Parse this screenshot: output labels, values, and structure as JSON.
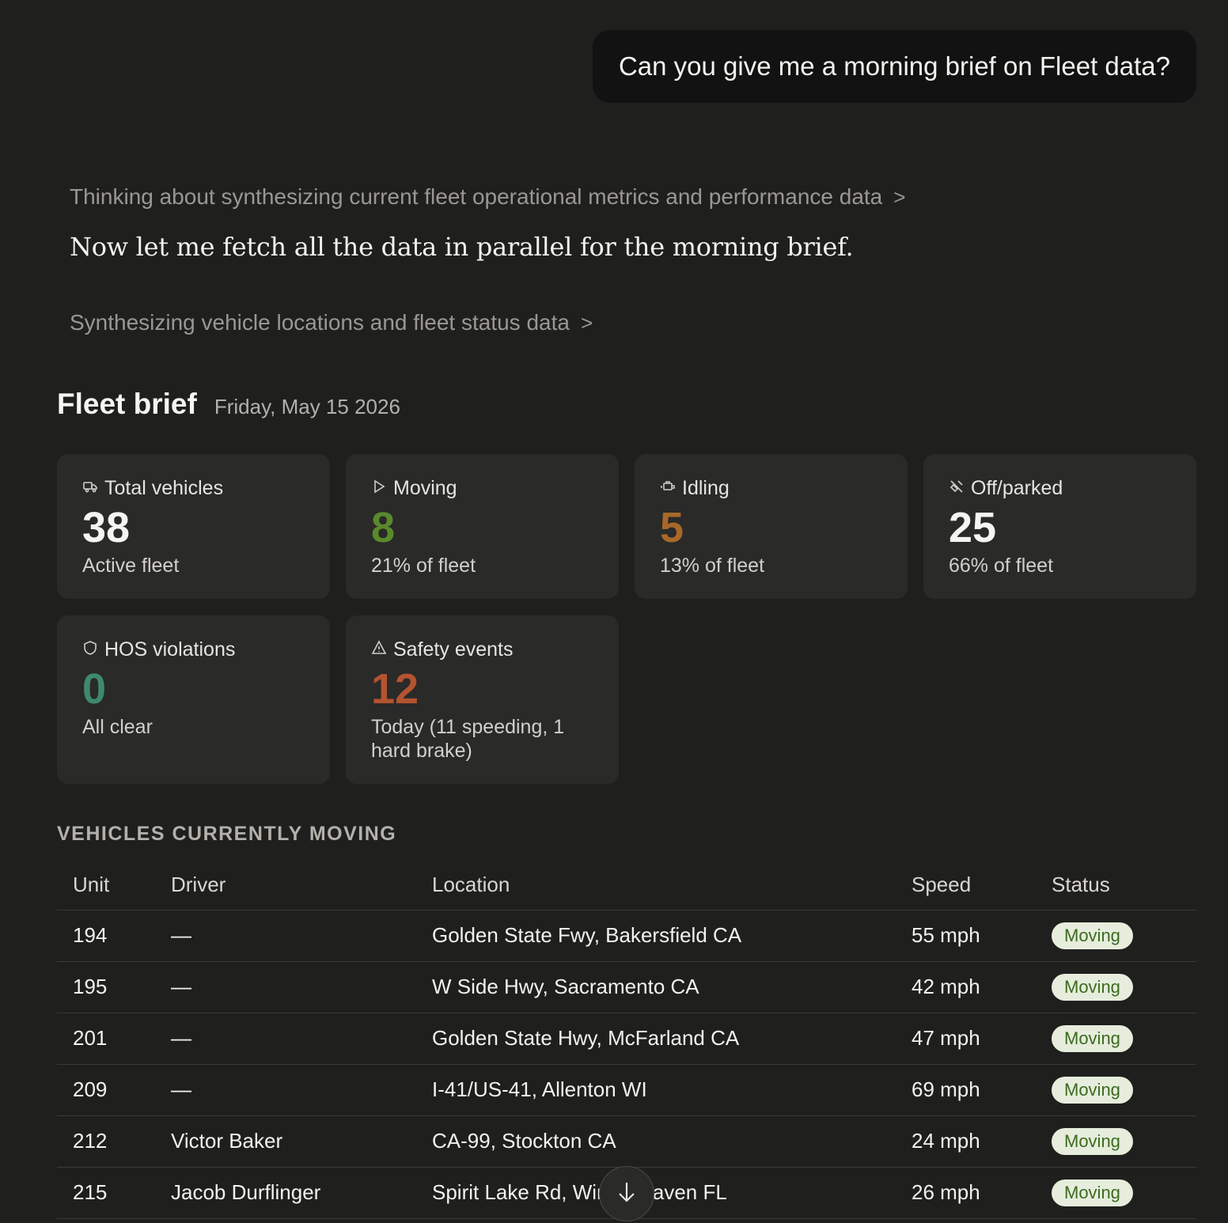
{
  "conversation": {
    "user_message": "Can you give me a morning brief on Fleet data?",
    "thinking_1": "Thinking about synthesizing current fleet operational metrics and performance data",
    "assistant_text": "Now let me fetch all the data in parallel for the morning brief.",
    "thinking_2": "Synthesizing vehicle locations and fleet status data",
    "chevron": ">"
  },
  "brief": {
    "title": "Fleet brief",
    "date": "Friday, May 15 2026"
  },
  "cards": {
    "total": {
      "label": "Total vehicles",
      "value": "38",
      "sub": "Active fleet",
      "icon": "truck-icon",
      "color": "#f6f5f0"
    },
    "moving": {
      "label": "Moving",
      "value": "8",
      "sub": "21% of fleet",
      "icon": "play-icon",
      "color": "#5a8a2c"
    },
    "idling": {
      "label": "Idling",
      "value": "5",
      "sub": "13% of fleet",
      "icon": "engine-icon",
      "color": "#a8682a"
    },
    "parked": {
      "label": "Off/parked",
      "value": "25",
      "sub": "66% of fleet",
      "icon": "parked-off-icon",
      "color": "#f6f5f0"
    },
    "hos": {
      "label": "HOS violations",
      "value": "0",
      "sub": "All clear",
      "icon": "shield-icon",
      "color": "#3f8a6c"
    },
    "safety": {
      "label": "Safety events",
      "value": "12",
      "sub": "Today (11 speeding, 1 hard brake)",
      "icon": "warning-icon",
      "color": "#b4532f"
    }
  },
  "table": {
    "section_title": "VEHICLES CURRENTLY MOVING",
    "headers": {
      "unit": "Unit",
      "driver": "Driver",
      "location": "Location",
      "speed": "Speed",
      "status": "Status"
    },
    "rows": [
      {
        "unit": "194",
        "driver": "—",
        "location": "Golden State Fwy, Bakersfield CA",
        "speed": "55 mph",
        "status": "Moving"
      },
      {
        "unit": "195",
        "driver": "—",
        "location": "W Side Hwy, Sacramento CA",
        "speed": "42 mph",
        "status": "Moving"
      },
      {
        "unit": "201",
        "driver": "—",
        "location": "Golden State Hwy, McFarland CA",
        "speed": "47 mph",
        "status": "Moving"
      },
      {
        "unit": "209",
        "driver": "—",
        "location": "I-41/US-41, Allenton WI",
        "speed": "69 mph",
        "status": "Moving"
      },
      {
        "unit": "212",
        "driver": "Victor Baker",
        "location": "CA-99, Stockton CA",
        "speed": "24 mph",
        "status": "Moving"
      },
      {
        "unit": "215",
        "driver": "Jacob Durflinger",
        "location": "Spirit Lake Rd, Winter Haven FL",
        "speed": "26 mph",
        "status": "Moving"
      }
    ]
  },
  "scroll_button": {
    "icon": "arrow-down-icon"
  }
}
